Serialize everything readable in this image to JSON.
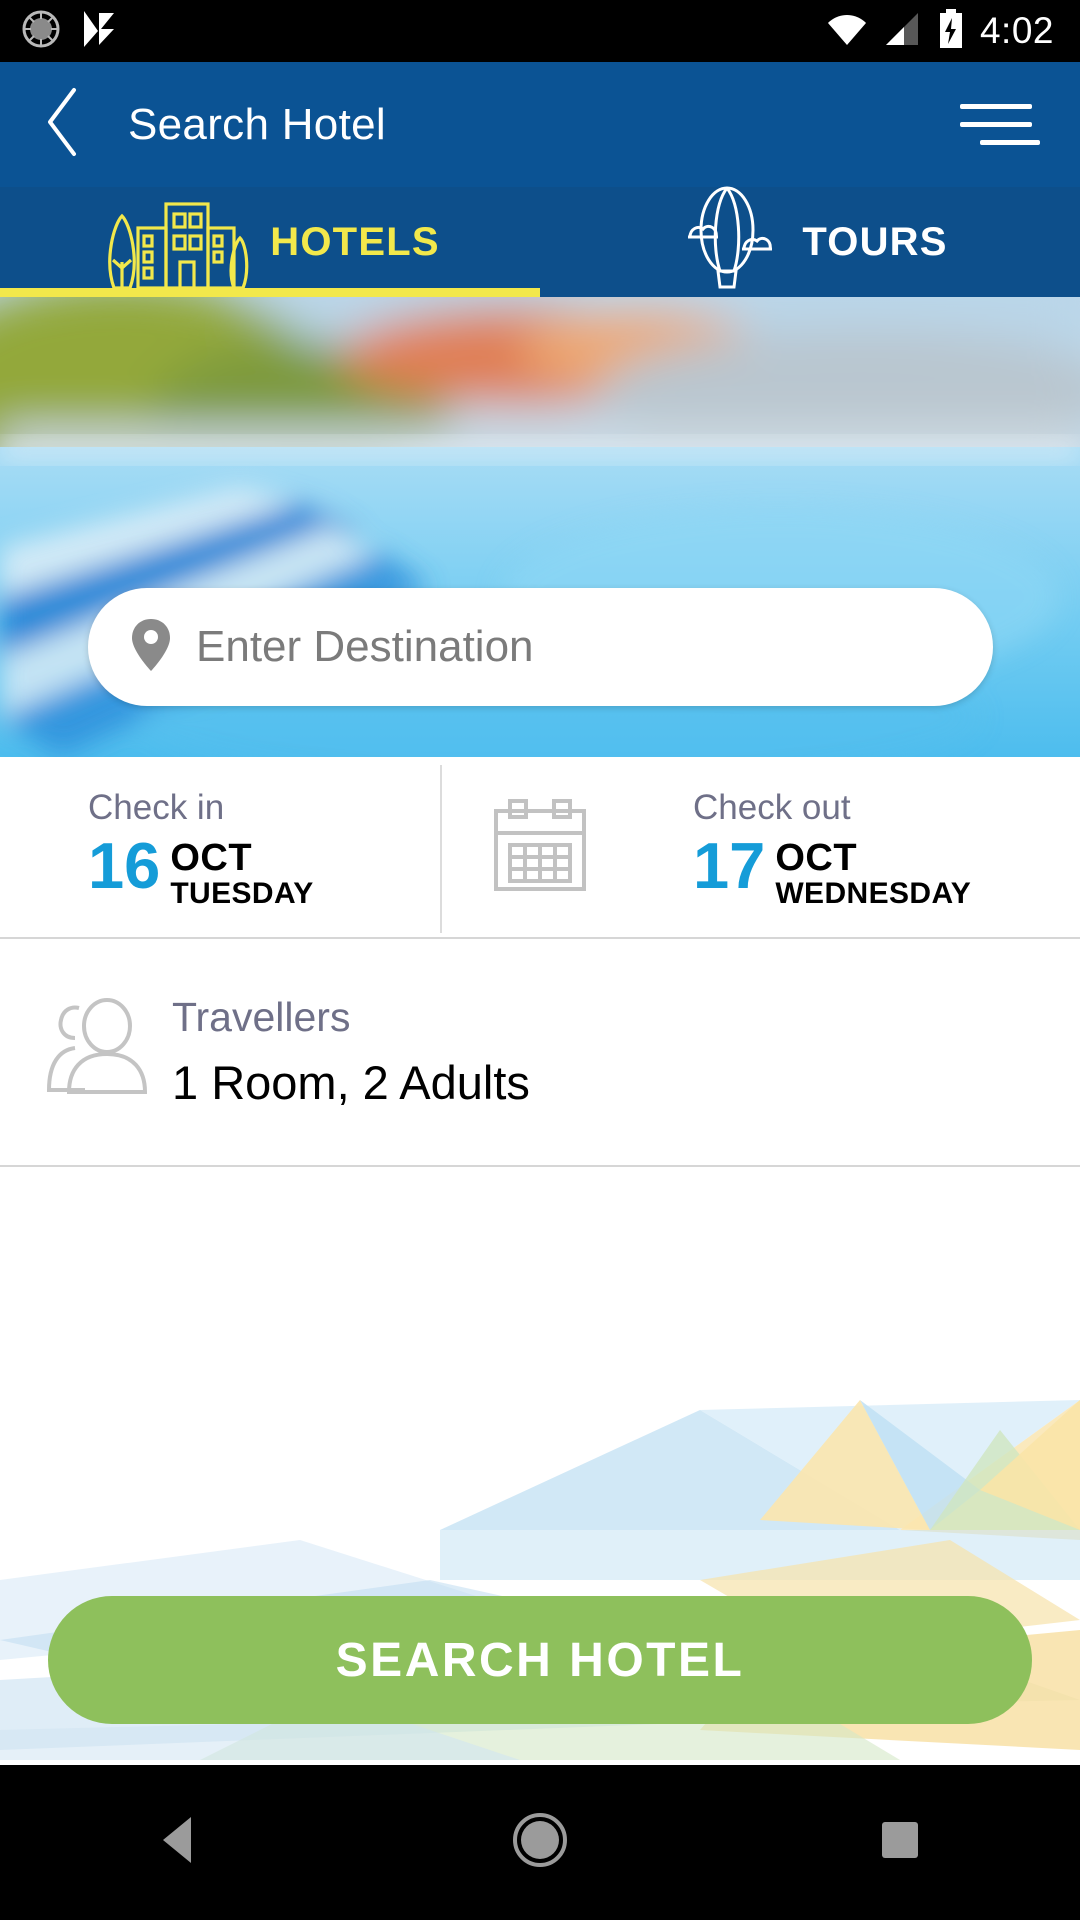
{
  "status_bar": {
    "time": "4:02",
    "icons": [
      "sync-icon",
      "app-notification-icon",
      "wifi-icon",
      "cellular-signal-icon",
      "battery-charging-icon"
    ]
  },
  "app_bar": {
    "title": "Search Hotel",
    "back_icon": "chevron-left-icon",
    "menu_icon": "hamburger-menu-icon",
    "background_color": "#0b5394"
  },
  "tabs": {
    "items": [
      {
        "label": "HOTELS",
        "icon": "hotel-building-icon",
        "active": true,
        "color": "#f2e84b"
      },
      {
        "label": "TOURS",
        "icon": "hot-air-balloon-icon",
        "active": false,
        "color": "#ffffff"
      }
    ],
    "indicator_color": "#f2e84b"
  },
  "search": {
    "placeholder": "Enter Destination",
    "icon": "location-pin-icon",
    "value": ""
  },
  "dates": {
    "calendar_icon": "calendar-icon",
    "check_in": {
      "label": "Check in",
      "day": "16",
      "month": "OCT",
      "weekday": "TUESDAY"
    },
    "check_out": {
      "label": "Check out",
      "day": "17",
      "month": "OCT",
      "weekday": "WEDNESDAY"
    },
    "accent_color": "#159cd8"
  },
  "travellers": {
    "icon": "travellers-people-icon",
    "label": "Travellers",
    "value": "1 Room, 2 Adults"
  },
  "primary_action": {
    "label": "SEARCH HOTEL",
    "color": "#8ec05c",
    "text_color": "#ffffff"
  },
  "android_nav": {
    "back_icon": "nav-back-triangle-icon",
    "home_icon": "nav-home-circle-icon",
    "recents_icon": "nav-recents-square-icon"
  }
}
